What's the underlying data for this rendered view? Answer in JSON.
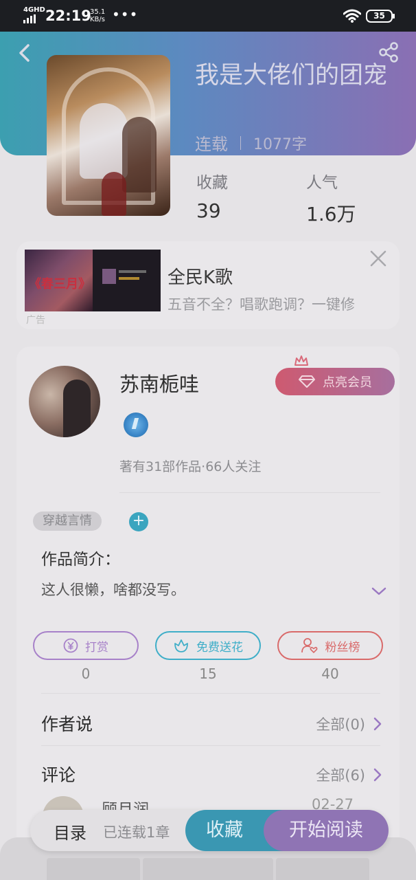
{
  "status_bar": {
    "network": "4GHD",
    "time": "22:19",
    "speed_value": "35.1",
    "speed_unit": "KB/s",
    "more": "•••",
    "battery": "35"
  },
  "book": {
    "title": "我是大佬们的团宠",
    "status": "连载",
    "word_count": "1077字",
    "favorites_label": "收藏",
    "favorites_value": "39",
    "popularity_label": "人气",
    "popularity_value": "1.6万"
  },
  "ad": {
    "image_text": "《春三月》",
    "title": "全民K歌",
    "description": "五音不全？唱歌跑调？一键修",
    "tag": "广告"
  },
  "author": {
    "name": "苏南栀哇",
    "vip_label": "点亮会员",
    "meta": "著有31部作品·66人关注",
    "genre_tag": "穿越言情",
    "add_tag": "+",
    "intro_title": "作品简介：",
    "intro_text": "这人很懒，啥都没写。"
  },
  "actions": {
    "reward_label": "打赏",
    "reward_count": "0",
    "flower_label": "免费送花",
    "flower_count": "15",
    "fans_label": "粉丝榜",
    "fans_count": "40"
  },
  "sections": {
    "author_says_title": "作者说",
    "author_says_link": "全部(0)",
    "comments_title": "评论",
    "comments_link": "全部(6)",
    "first_comment_name": "顾月润",
    "first_comment_date": "02-27"
  },
  "bottom_bar": {
    "toc_label": "目录",
    "serial_label": "已连载1章",
    "favorite_button": "收藏",
    "read_button": "开始阅读"
  },
  "colors": {
    "header_start": "#3c9fb0",
    "header_end": "#8a6fb3",
    "accent_teal": "#3a97b2",
    "accent_purple": "#8f74b4",
    "vip_pink": "#ce5a70"
  },
  "icons": [
    "back-icon",
    "share-icon",
    "close-icon",
    "crown-icon",
    "diamond-icon",
    "medal-icon",
    "chevron-down-icon",
    "yuan-icon",
    "flower-icon",
    "user-heart-icon",
    "chevron-right-icon",
    "wifi-icon",
    "signal-icon"
  ]
}
